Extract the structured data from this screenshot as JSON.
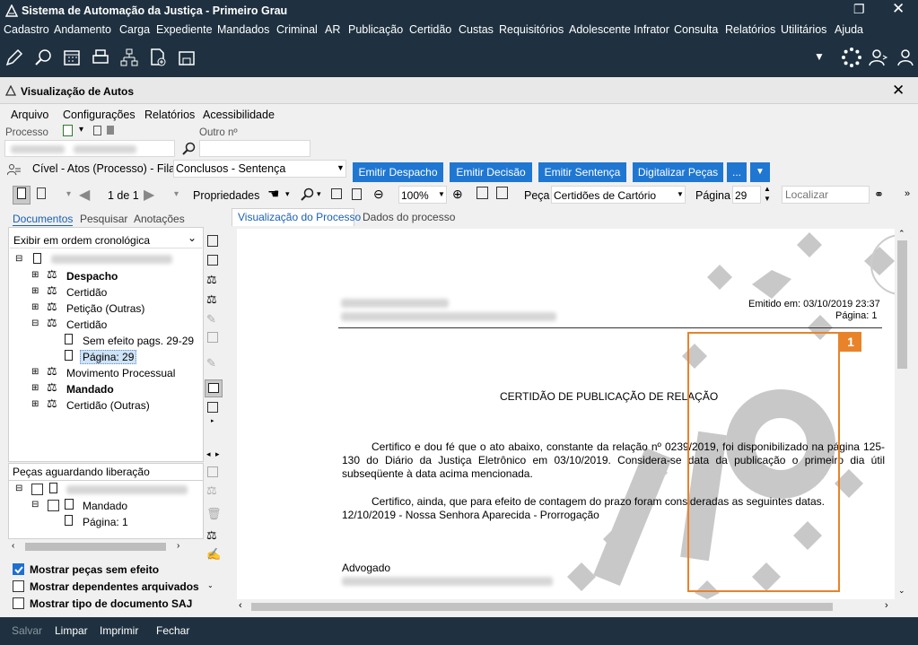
{
  "window": {
    "title": "Sistema de Automação da Justiça - Primeiro Grau"
  },
  "menu": [
    "Cadastro",
    "Andamento",
    "Carga",
    "Expediente",
    "Mandados",
    "Criminal",
    "AR",
    "Publicação",
    "Certidão",
    "Custas",
    "Requisitórios",
    "Adolescente Infrator",
    "Consulta",
    "Relatórios",
    "Utilitários",
    "Ajuda"
  ],
  "viewer": {
    "title": "Visualização de Autos",
    "submenu": [
      "Arquivo",
      "Configurações",
      "Relatórios",
      "Acessibilidade"
    ],
    "processo_label": "Processo",
    "outro_label": "Outro nº",
    "fila_label": "Cível - Atos (Processo) - Fila:",
    "fila_value": "Conclusos - Sentença",
    "buttons": [
      "Emitir Despacho",
      "Emitir Decisão",
      "Emitir Sentença",
      "Digitalizar Peças",
      "..."
    ],
    "toolbar": {
      "page_counter": "1 de 1",
      "propriedades": "Propriedades",
      "zoom": "100%",
      "peca_label": "Peça",
      "peca_value": "Certidões de Cartório",
      "pagina_label": "Página",
      "pagina_value": "29",
      "localizar_placeholder": "Localizar"
    }
  },
  "left_panel": {
    "tabs": [
      "Documentos",
      "Pesquisar",
      "Anotações"
    ],
    "order_select": "Exibir em ordem cronológica",
    "tree": [
      "Despacho",
      "Certidão",
      "Petição (Outras)",
      "Certidão",
      "Sem efeito pags. 29-29",
      "Página: 29",
      "Movimento Processual",
      "Mandado",
      "Certidão (Outras)"
    ],
    "pending_title": "Peças aguardando liberação",
    "pending_tree": [
      "Mandado",
      "Página: 1"
    ],
    "options": [
      {
        "label": "Mostrar peças sem efeito",
        "checked": true
      },
      {
        "label": "Mostrar dependentes arquivados",
        "checked": false
      },
      {
        "label": "Mostrar tipo de documento SAJ",
        "checked": false
      }
    ]
  },
  "right_tabs": [
    "Visualização do Processo",
    "Dados do processo"
  ],
  "document": {
    "emitido": "Emitido em: 03/10/2019 23:37",
    "pagina": "Página: 1",
    "heading": "CERTIDÃO DE PUBLICAÇÃO DE RELAÇÃO",
    "para1": "Certifico e dou fé que o ato abaixo, constante da relação nº 0239/2019, foi disponibilizado na página 125-130 do Diário da Justiça Eletrônico em 03/10/2019. Considera-se data da publicação o primeiro dia útil subseqüente à data acima mencionada.",
    "para2": "Certifico, ainda, que para efeito de contagem do prazo foram consideradas as seguintes datas.",
    "dates_line": "12/10/2019 - Nossa Senhora Aparecida - Prorrogação",
    "advogado": "Advogado",
    "badge": "1"
  },
  "statusbar": [
    "Salvar",
    "Limpar",
    "Imprimir",
    "Fechar"
  ]
}
